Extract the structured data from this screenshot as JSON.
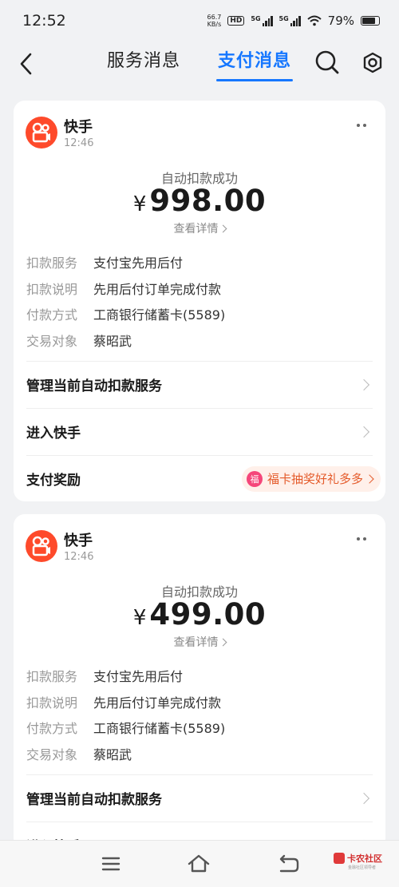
{
  "status_bar": {
    "time": "12:52",
    "speed_value": "66.7",
    "speed_unit": "KB/s",
    "hd": "HD",
    "signal_1": "5G",
    "signal_2": "5G",
    "battery": "79%",
    "battery_level": 0.79
  },
  "header": {
    "tabs": [
      "服务消息",
      "支付消息"
    ],
    "active_tab": "支付消息"
  },
  "cards": [
    {
      "merchant": "快手",
      "time": "12:46",
      "status": "自动扣款成功",
      "currency": "¥",
      "amount": "998.00",
      "detail_link": "查看详情",
      "info": [
        {
          "label": "扣款服务",
          "value": "支付宝先用后付"
        },
        {
          "label": "扣款说明",
          "value": "先用后付订单完成付款"
        },
        {
          "label": "付款方式",
          "value": "工商银行储蓄卡(5589)"
        },
        {
          "label": "交易对象",
          "value": "蔡昭武"
        }
      ],
      "actions": [
        "管理当前自动扣款服务",
        "进入快手",
        "支付奖励"
      ],
      "reward_text": "福卡抽奖好礼多多",
      "reward_icon": "福"
    },
    {
      "merchant": "快手",
      "time": "12:46",
      "status": "自动扣款成功",
      "currency": "¥",
      "amount": "499.00",
      "detail_link": "查看详情",
      "info": [
        {
          "label": "扣款服务",
          "value": "支付宝先用后付"
        },
        {
          "label": "扣款说明",
          "value": "先用后付订单完成付款"
        },
        {
          "label": "付款方式",
          "value": "工商银行储蓄卡(5589)"
        },
        {
          "label": "交易对象",
          "value": "蔡昭武"
        }
      ],
      "actions": [
        "管理当前自动扣款服务",
        "进入快手"
      ]
    }
  ],
  "watermark": {
    "text": "卡农社区",
    "sub": "金融社区领导者"
  },
  "colors": {
    "accent": "#1677ff",
    "kuaishou_brand": "#fe4a2b",
    "reward": "#e45a2a",
    "background": "#f1f2f4"
  }
}
